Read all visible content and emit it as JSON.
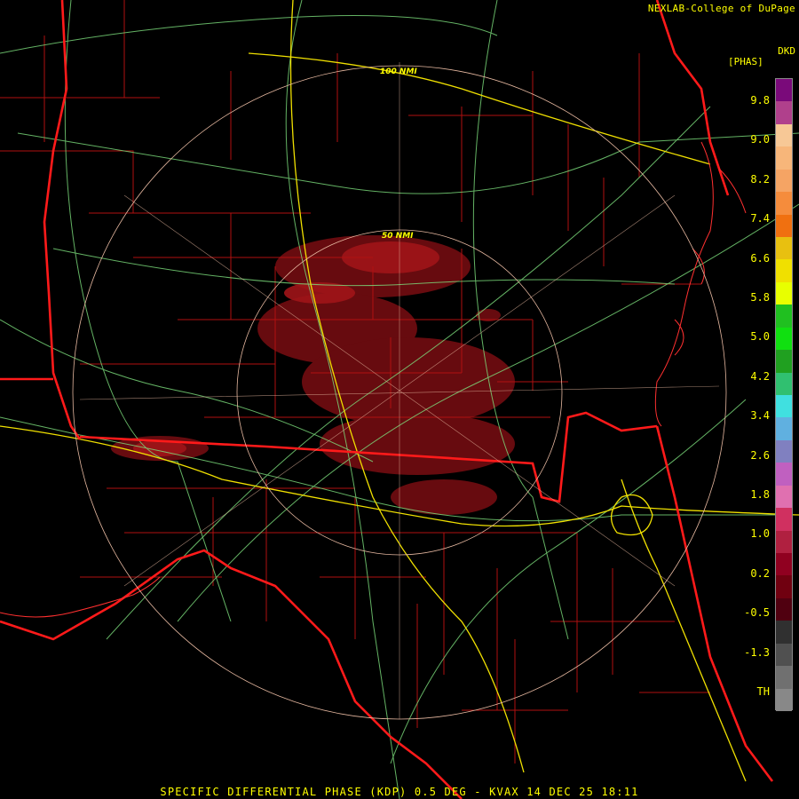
{
  "credit": "NEXLAB-College of DuPage",
  "units": {
    "line1": "DKD",
    "line2": "[PHAS]"
  },
  "range_rings": {
    "inner": "50 NMI",
    "outer": "100 NMI"
  },
  "legend_ticks": [
    "9.8",
    "9.0",
    "8.2",
    "7.4",
    "6.6",
    "5.8",
    "5.0",
    "4.2",
    "3.4",
    "2.6",
    "1.8",
    "1.0",
    "0.2",
    "-0.5",
    "-1.3",
    "TH"
  ],
  "colorbar": {
    "colors": [
      "#7a0a7a",
      "#b0408c",
      "#f7c896",
      "#f7b67a",
      "#f5a464",
      "#f58c3c",
      "#f07010",
      "#e8c010",
      "#f0e000",
      "#e8ff00",
      "#20c020",
      "#10e010",
      "#20a020",
      "#30c070",
      "#40e0e0",
      "#60b0e0",
      "#8080c0",
      "#c060c0",
      "#e070b0",
      "#d03060",
      "#b02040",
      "#900020",
      "#700010",
      "#500010",
      "#303030",
      "#505050",
      "#707070",
      "#888888"
    ]
  },
  "caption": "SPECIFIC DIFFERENTIAL PHASE (KDP) 0.5 DEG - KVAX 14 DEC 25 18:11"
}
